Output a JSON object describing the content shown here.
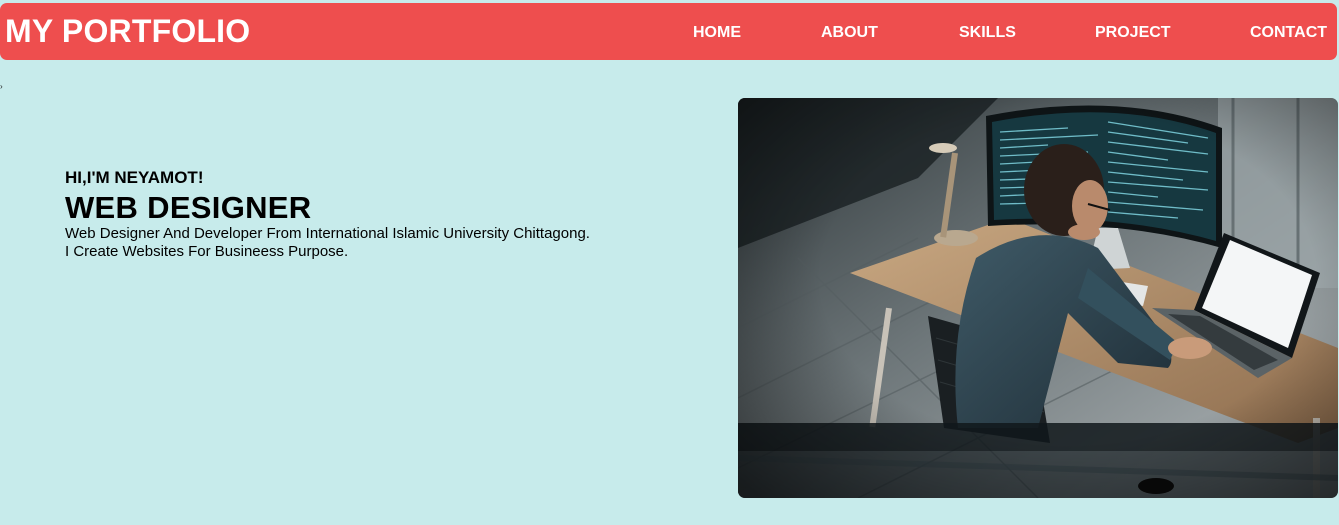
{
  "brand": "MY PORTFOLIO",
  "nav": {
    "home": "HOME",
    "about": "ABOUT",
    "skills": "SKILLS",
    "project": "PROJECT",
    "contact": "CONTACT"
  },
  "hero": {
    "greeting": "HI,I'M NEYAMOT!",
    "role": "WEB DESIGNER",
    "line1": "Web Designer And Developer From International Islamic University Chittagong.",
    "line2": "I Create Websites For Busineess Purpose."
  },
  "colors": {
    "navbar": "#ee4e4e",
    "background": "#c7ebeb"
  }
}
